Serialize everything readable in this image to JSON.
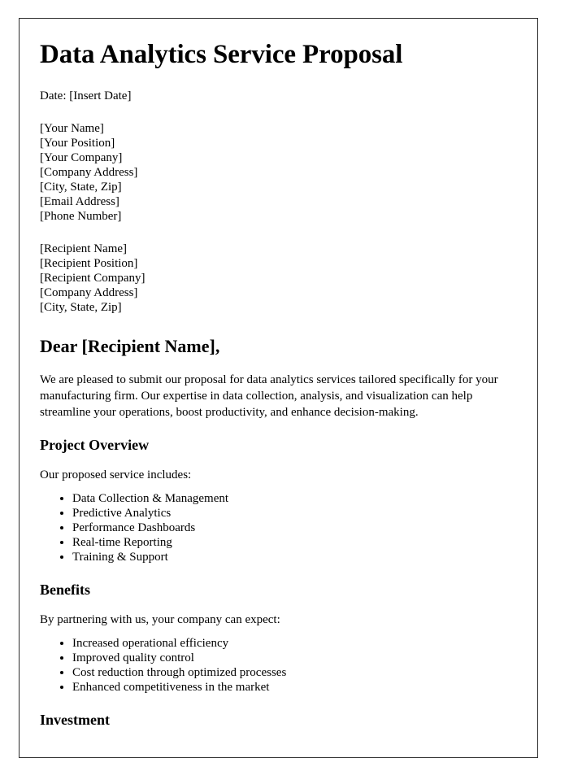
{
  "document": {
    "title": "Data Analytics Service Proposal",
    "date_line": "Date: [Insert Date]",
    "sender_block": [
      "[Your Name]",
      "[Your Position]",
      "[Your Company]",
      "[Company Address]",
      "[City, State, Zip]",
      "[Email Address]",
      "[Phone Number]"
    ],
    "recipient_block": [
      "[Recipient Name]",
      "[Recipient Position]",
      "[Recipient Company]",
      "[Company Address]",
      "[City, State, Zip]"
    ],
    "salutation": "Dear [Recipient Name],",
    "intro_paragraph": "We are pleased to submit our proposal for data analytics services tailored specifically for your manufacturing firm. Our expertise in data collection, analysis, and visualization can help streamline your operations, boost productivity, and enhance decision-making.",
    "sections": [
      {
        "heading": "Project Overview",
        "lead_in": "Our proposed service includes:",
        "items": [
          "Data Collection & Management",
          "Predictive Analytics",
          "Performance Dashboards",
          "Real-time Reporting",
          "Training & Support"
        ]
      },
      {
        "heading": "Benefits",
        "lead_in": "By partnering with us, your company can expect:",
        "items": [
          "Increased operational efficiency",
          "Improved quality control",
          "Cost reduction through optimized processes",
          "Enhanced competitiveness in the market"
        ]
      },
      {
        "heading": "Investment"
      }
    ]
  }
}
